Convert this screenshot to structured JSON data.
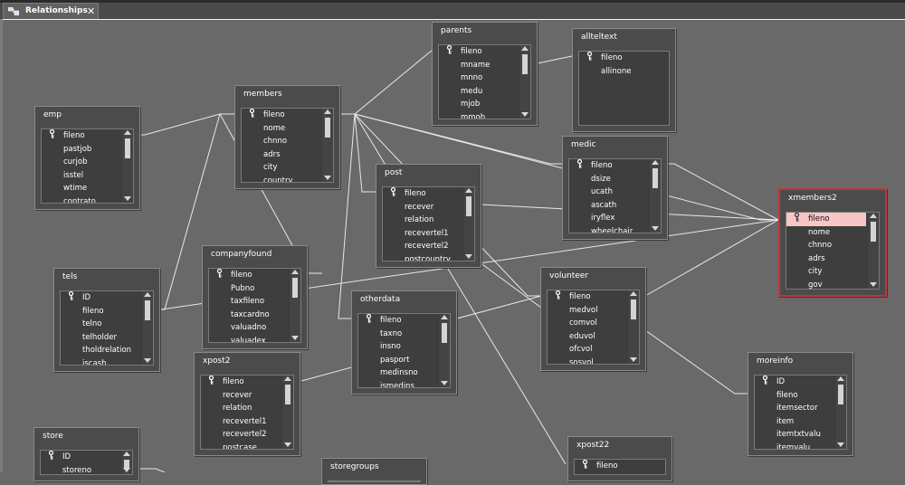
{
  "tab": {
    "label": "Relationships",
    "close": "✕"
  },
  "key_glyph": "🔑",
  "tables": [
    {
      "id": "emp",
      "title": "emp",
      "fields": [
        "fileno",
        "pastjob",
        "curjob",
        "isstel",
        "wtime",
        "contrato"
      ],
      "key_index": 0
    },
    {
      "id": "members",
      "title": "members",
      "fields": [
        "fileno",
        "nome",
        "chnno",
        "adrs",
        "city",
        "country"
      ],
      "key_index": 0
    },
    {
      "id": "parents",
      "title": "parents",
      "fields": [
        "fileno",
        "mname",
        "mnno",
        "medu",
        "mjob",
        "mmob"
      ],
      "key_index": 0
    },
    {
      "id": "allteltext",
      "title": "allteltext",
      "fields": [
        "fileno",
        "allinone"
      ],
      "key_index": 0
    },
    {
      "id": "medic",
      "title": "medic",
      "fields": [
        "fileno",
        "dsize",
        "ucath",
        "ascath",
        "iryflex",
        "wheelchair"
      ],
      "key_index": 0
    },
    {
      "id": "post",
      "title": "post",
      "fields": [
        "fileno",
        "recever",
        "relation",
        "recevertel1",
        "recevertel2",
        "postcountry"
      ],
      "key_index": 0
    },
    {
      "id": "xmembers2",
      "title": "xmembers2",
      "fields": [
        "fileno",
        "nome",
        "chnno",
        "adrs",
        "city",
        "gov"
      ],
      "key_index": 0,
      "selected": true
    },
    {
      "id": "tels",
      "title": "tels",
      "fields": [
        "ID",
        "fileno",
        "telno",
        "telholder",
        "tholdrelation",
        "iscash"
      ],
      "key_index": 0
    },
    {
      "id": "companyfound",
      "title": "companyfound",
      "fields": [
        "fileno",
        "Pubno",
        "taxfileno",
        "taxcardno",
        "valuadno",
        "valuadex"
      ],
      "key_index": 0
    },
    {
      "id": "otherdata",
      "title": "otherdata",
      "fields": [
        "fileno",
        "taxno",
        "insno",
        "pasport",
        "medinsno",
        "ismedins"
      ],
      "key_index": 0
    },
    {
      "id": "volunteer",
      "title": "volunteer",
      "fields": [
        "fileno",
        "medvol",
        "comvol",
        "eduvol",
        "ofcvol",
        "sosvol"
      ],
      "key_index": 0
    },
    {
      "id": "xpost2",
      "title": "xpost2",
      "fields": [
        "fileno",
        "recever",
        "relation",
        "recevertel1",
        "recevertel2",
        "postcase"
      ],
      "key_index": 0
    },
    {
      "id": "moreinfo",
      "title": "moreinfo",
      "fields": [
        "ID",
        "fileno",
        "itemsector",
        "item",
        "itemtxtvalu",
        "itemvalu"
      ],
      "key_index": 0
    },
    {
      "id": "store",
      "title": "store",
      "fields": [
        "ID",
        "storeno"
      ],
      "key_index": 0
    },
    {
      "id": "xpost22",
      "title": "xpost22",
      "fields": [
        "fileno"
      ],
      "key_index": 0
    },
    {
      "id": "storegroups",
      "title": "storegroups",
      "fields": [],
      "key_index": -1
    }
  ]
}
